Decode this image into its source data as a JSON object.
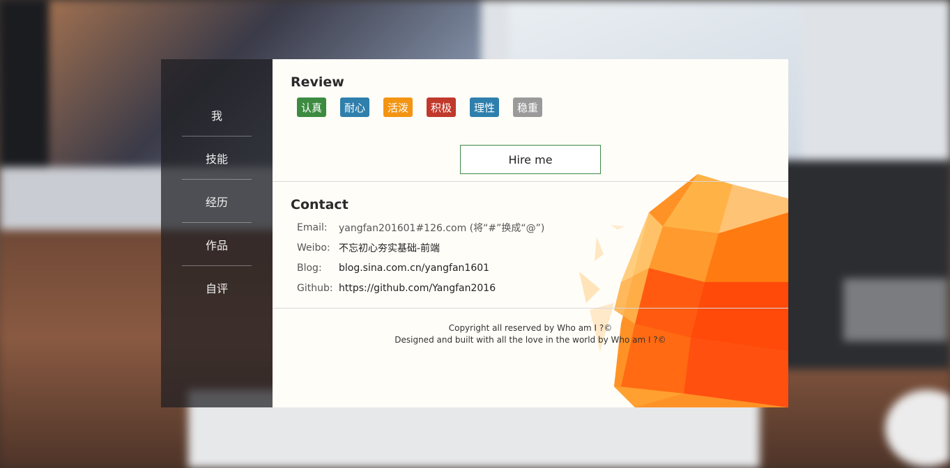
{
  "nav": {
    "items": [
      "我",
      "技能",
      "经历",
      "作品",
      "自评"
    ]
  },
  "review": {
    "title": "Review",
    "tags": [
      {
        "label": "认真",
        "color": "#3d8b40"
      },
      {
        "label": "耐心",
        "color": "#2f7fad"
      },
      {
        "label": "活泼",
        "color": "#f39512"
      },
      {
        "label": "积极",
        "color": "#c0392b"
      },
      {
        "label": "理性",
        "color": "#2f7fad"
      },
      {
        "label": "稳重",
        "color": "#9a9a9a"
      }
    ],
    "hire_label": "Hire me"
  },
  "contact": {
    "title": "Contact",
    "rows": [
      {
        "key": "Email:",
        "value": "yangfan201601#126.com (将“#”换成“@”)"
      },
      {
        "key": "Weibo:",
        "value": "不忘初心夯实基础-前端"
      },
      {
        "key": "Blog:",
        "value": "blog.sina.com.cn/yangfan1601"
      },
      {
        "key": "Github:",
        "value": "https://github.com/Yangfan2016"
      }
    ]
  },
  "footer": {
    "line1": "Copyright all reserved by Who am I ?©",
    "line2": "Designed and built with all the love in the world by Who am I ?©"
  }
}
